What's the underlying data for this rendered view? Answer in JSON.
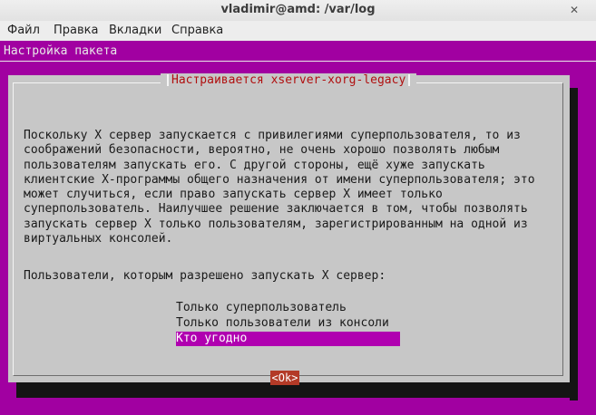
{
  "window": {
    "title": "vladimir@amd: /var/log",
    "close_icon": "✕"
  },
  "menubar": {
    "items": [
      "Файл",
      "Правка",
      "Вкладки",
      "Справка"
    ]
  },
  "terminal": {
    "background": "#a100a1",
    "header": "Настройка пакета",
    "dialog": {
      "title": "Настраивается xserver-xorg-legacy",
      "description_lines": [
        "Поскольку X сервер запускается с привилегиями суперпользователя, то из",
        "соображений безопасности, вероятно, не очень хорошо позволять любым",
        "пользователям запускать его. С другой стороны, ещё хуже запускать",
        "клиентские X-программы общего назначения от имени суперпользователя; это",
        "может случиться, если право запускать сервер X имеет только",
        "суперпользователь. Наилучшее решение заключается в том, чтобы позволять",
        "запускать сервер X только пользователям, зарегистрированным на одной из",
        "виртуальных консолей."
      ],
      "prompt": "Пользователи, которым разрешено запускать X сервер:",
      "options": [
        {
          "label": "Только суперпользователь",
          "selected": false
        },
        {
          "label": "Только пользователи из консоли",
          "selected": false
        },
        {
          "label": "Кто угодно",
          "selected": true
        }
      ],
      "ok_button": "<Ok>",
      "ok_color": "#b33a27",
      "selection_color": "#b000b0"
    }
  }
}
